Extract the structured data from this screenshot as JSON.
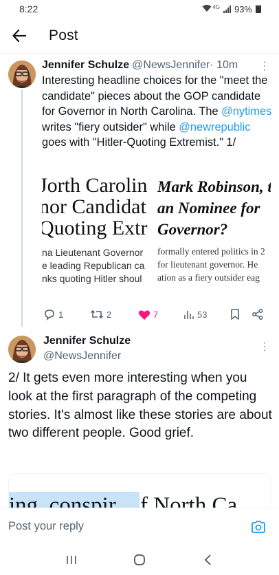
{
  "status_bar": {
    "time": "8:22",
    "network": "4G",
    "battery": "93%"
  },
  "header": {
    "title": "Post"
  },
  "tweet1": {
    "name": "Jennifer Schulze",
    "handle": "@NewsJennifer",
    "time": "· 10m",
    "text_parts": {
      "p1": "Interesting headline choices for the \"meet the candidate\" pieces about the GOP candidate for Governor in North Carolina. The ",
      "link1": "@nytimes",
      "p2": " writes \"fiery outsider\" while ",
      "link2": "@newrepublic",
      "p3": " goes with \"Hitler-Quoting Extremist.\"  1/"
    },
    "card": {
      "left_headline": [
        "Jorth Carolin",
        "nor Candidat",
        "Quoting Extr"
      ],
      "left_sub": [
        "na Lieutenant Governor",
        "e leading Republican ca",
        "nks quoting Hitler shoul"
      ],
      "right_headline": [
        "Mark Robinson, t",
        "an Nominee for",
        "Governor?"
      ],
      "right_sub": [
        "formally entered politics in 2",
        "for lieutenant governor. He",
        "ation as a fiery outsider eag"
      ]
    },
    "stats": {
      "replies": "1",
      "reposts": "2",
      "likes": "7",
      "views": "53"
    },
    "like_color": "#f91880"
  },
  "tweet2": {
    "name": "Jennifer Schulze",
    "handle": "@NewsJennifer",
    "text": "2/  It gets even more interesting when you look at the first paragraph of the competing stories.  It's almost like these stories are about two different people. Good grief.",
    "card_left": "ing, conspir",
    "card_right": "f North Ca"
  },
  "reply": {
    "placeholder": "Post your reply"
  },
  "accent_color": "#1d9bf0"
}
